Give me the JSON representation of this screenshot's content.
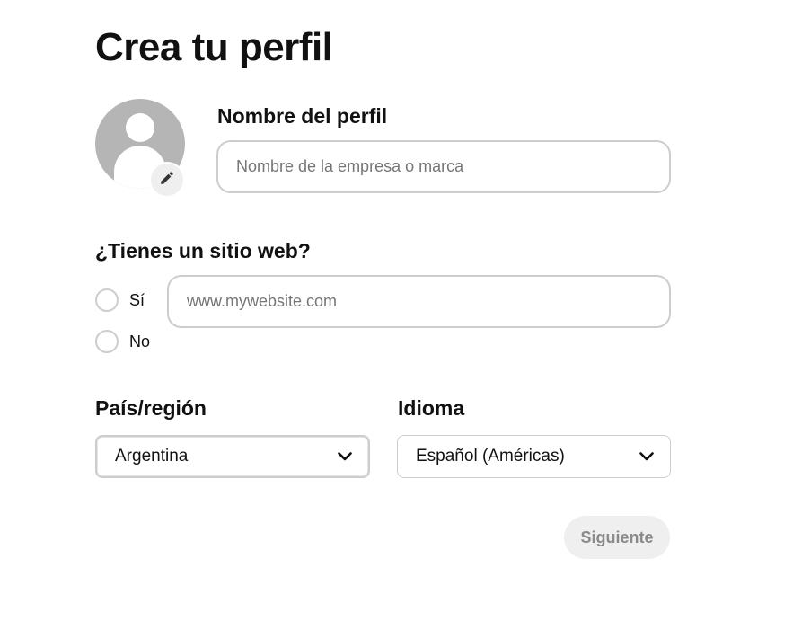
{
  "page": {
    "title": "Crea tu perfil"
  },
  "profile": {
    "avatar_icon": "user-avatar-icon",
    "edit_icon": "pencil-icon",
    "name_label": "Nombre del perfil",
    "name_placeholder": "Nombre de la empresa o marca",
    "name_value": ""
  },
  "website": {
    "question": "¿Tienes un sitio web?",
    "options": [
      {
        "label": "Sí",
        "selected": false
      },
      {
        "label": "No",
        "selected": false
      }
    ],
    "url_placeholder": "www.mywebsite.com",
    "url_value": ""
  },
  "country": {
    "label": "País/región",
    "selected": "Argentina",
    "icon": "chevron-down-icon"
  },
  "language": {
    "label": "Idioma",
    "selected": "Español (Américas)",
    "icon": "chevron-down-icon"
  },
  "actions": {
    "next_label": "Siguiente"
  },
  "colors": {
    "avatar_bg": "#b5b5b5",
    "border": "#cdcdcd",
    "button_bg": "#efefef",
    "button_text_disabled": "#8a8a8a"
  }
}
